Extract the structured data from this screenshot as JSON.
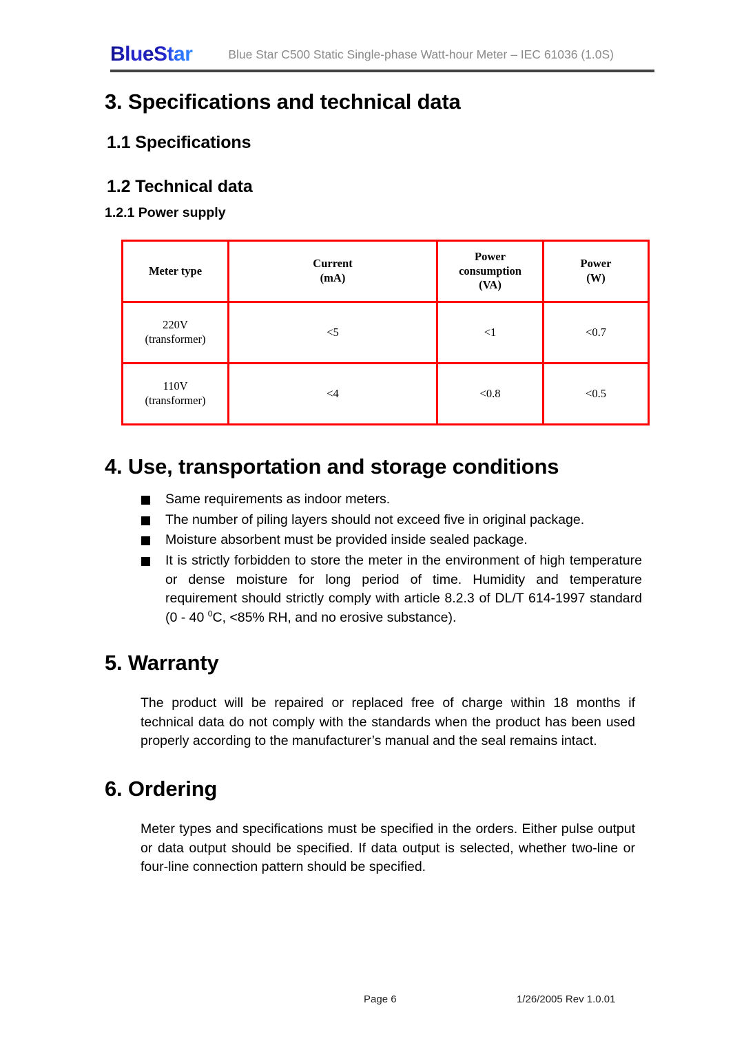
{
  "header": {
    "logo_text": "BlueStar",
    "title": "Blue Star C500 Static Single-phase Watt-hour Meter – IEC 61036 (1.0S)"
  },
  "headings": {
    "section_3": "3.  Specifications and technical data",
    "section_1_1": "1.1   Specifications",
    "section_1_2": "1.2   Technical data",
    "section_1_2_1": "1.2.1 Power supply",
    "section_4": "4.  Use, transportation and storage conditions",
    "section_5": "5.  Warranty",
    "section_6": "6.  Ordering"
  },
  "power_supply_table": {
    "columns": [
      {
        "line1": "Meter type",
        "line2": ""
      },
      {
        "line1": "Current",
        "line2": "(mA)"
      },
      {
        "line1": "Power",
        "line2": "consumption",
        "line3": "(VA)"
      },
      {
        "line1": "Power",
        "line2": "(W)"
      }
    ],
    "rows": [
      {
        "meter_type_line1": "220V",
        "meter_type_line2": "(transformer)",
        "current_ma": "<5",
        "power_consumption_va": "<1",
        "power_w": "<0.7"
      },
      {
        "meter_type_line1": "110V",
        "meter_type_line2": "(transformer)",
        "current_ma": "<4",
        "power_consumption_va": "<0.8",
        "power_w": "<0.5"
      }
    ],
    "border_color": "#ff0000"
  },
  "use_conditions": {
    "bullets": [
      "Same requirements as indoor meters.",
      "The number of piling layers should not exceed five in original package.",
      "Moisture absorbent must be provided inside sealed package."
    ],
    "bullet_4_part1": "It is strictly forbidden to store the meter in the environment of high temperature or dense moisture for long period of time. Humidity and temperature requirement should strictly comply with article 8.2.3 of DL/T 614-1997 standard (0 - 40 ",
    "bullet_4_superscript": "0",
    "bullet_4_part2": "C, <85% RH, and no erosive substance)."
  },
  "warranty": {
    "paragraph": "The product will be repaired or replaced free of charge within 18 months if technical data do not comply with the standards when the product has been used properly according to the manufacturer’s manual and the seal remains intact."
  },
  "ordering": {
    "paragraph": "Meter types and specifications must be specified in the orders. Either pulse output or data output should be specified. If data output is selected, whether two-line or four-line connection pattern should be specified."
  },
  "footer": {
    "page_label": "Page 6",
    "revision": "1/26/2005   Rev 1.0.01"
  }
}
